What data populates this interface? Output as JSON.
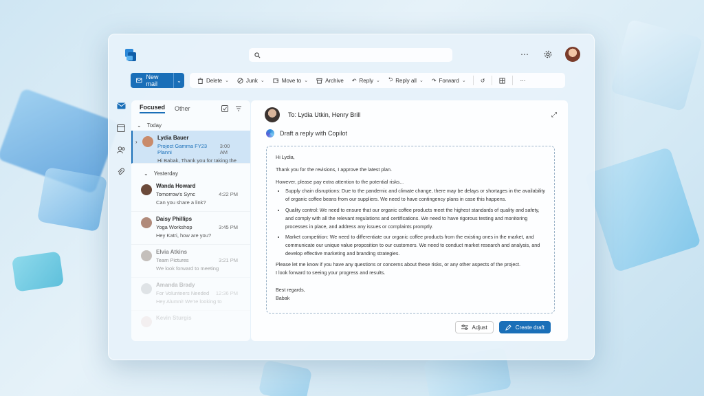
{
  "topbar": {
    "search_placeholder": ""
  },
  "toolbar": {
    "new_mail_label": "New mail",
    "items": [
      {
        "label": "Delete",
        "icon": "trash-icon"
      },
      {
        "label": "Junk",
        "icon": "block-icon"
      },
      {
        "label": "Move to",
        "icon": "move-icon"
      },
      {
        "label": "Archive",
        "icon": "archive-icon"
      },
      {
        "label": "Reply",
        "icon": "reply-icon"
      },
      {
        "label": "Reply all",
        "icon": "reply-all-icon"
      },
      {
        "label": "Forward",
        "icon": "forward-icon"
      }
    ]
  },
  "list": {
    "tab_focused": "Focused",
    "tab_other": "Other",
    "group_today": "Today",
    "group_yesterday": "Yesterday",
    "mails": [
      {
        "sender": "Lydia Bauer",
        "subject": "Project Gamma FY23 Planni",
        "time": "3:00 AM",
        "preview": "Hi Babak, Thank you for taking the",
        "selected": true,
        "avatar_color": "#c98b6b"
      },
      {
        "sender": "Wanda Howard",
        "subject": "Tomorrow's Sync",
        "time": "4:22 PM",
        "preview": "Can you share a link?",
        "avatar_color": "#6b4a3a"
      },
      {
        "sender": "Daisy Phillips",
        "subject": "Yoga Workshop",
        "time": "3:45 PM",
        "preview": "Hey Katri, how are you?",
        "avatar_color": "#b08a7a"
      },
      {
        "sender": "Elvia Atkins",
        "subject": "Team Pictures",
        "time": "3:21 PM",
        "preview": "We look forward to meeting",
        "avatar_color": "#9a8e86"
      },
      {
        "sender": "Amanda Brady",
        "subject": "For Volunteers Needed",
        "time": "12:36 PM",
        "preview": "Hey Alumni! We're looking to",
        "avatar_color": "#a0a6ab"
      },
      {
        "sender": "Kevin Sturgis",
        "subject": "",
        "time": "",
        "preview": "",
        "avatar_color": "#d1a6a0"
      }
    ]
  },
  "reading": {
    "to_line": "To: Lydia Utkin, Henry Brill",
    "copilot_label": "Draft a reply with Copilot",
    "greeting": "Hi Lydia,",
    "p1": "Thank you for the revisions, I approve the latest plan.",
    "p2": "However, please pay extra attention to the potential risks...",
    "bullets": [
      "Supply chain disruptions: Due to the pandemic and climate change, there may be delays or shortages in the availability of organic coffee beans from our suppliers. We need to have contingency plans in case this happens.",
      "Quality control: We need to ensure that our organic coffee products meet the highest standards of quality and safety, and comply with all the relevant regulations and certifications. We need to have rigorous testing and monitoring processes in place, and address any issues or complaints promptly.",
      "Market competition: We need to differentiate our organic coffee products from the existing ones in the market, and communicate our unique value proposition to our customers. We need to conduct market research and analysis, and develop effective marketing and branding strategies."
    ],
    "p3": "Please let me know if you have any questions or concerns about these risks, or any other aspects of the project.",
    "p4": "I look forward to seeing your progress and results.",
    "closing": "Best regards,",
    "signature": "Babak",
    "adjust_label": "Adjust",
    "create_label": "Create draft"
  },
  "colors": {
    "accent": "#1a6fb8",
    "selected_bg": "#cfe4f6"
  }
}
